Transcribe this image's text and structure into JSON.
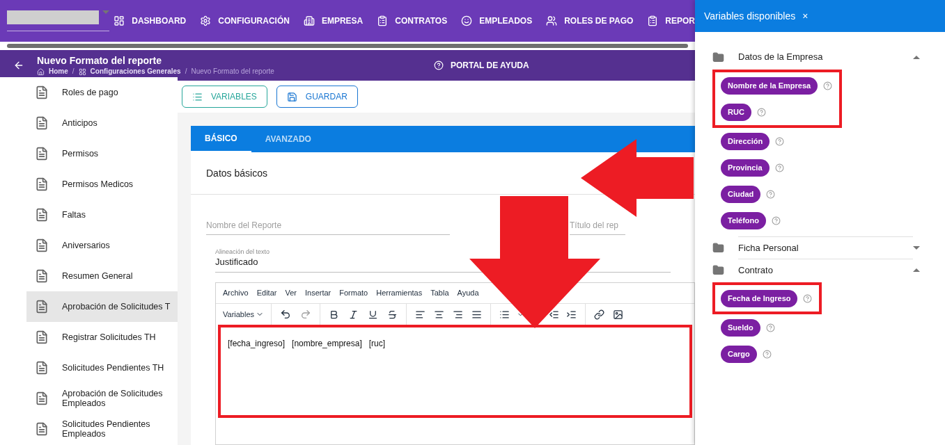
{
  "nav": {
    "items": [
      {
        "kind": "dashboard",
        "label": "DASHBOARD"
      },
      {
        "kind": "gear",
        "label": "CONFIGURACIÓN"
      },
      {
        "kind": "building",
        "label": "EMPRESA"
      },
      {
        "kind": "clipboard",
        "label": "CONTRATOS"
      },
      {
        "kind": "face",
        "label": "EMPLEADOS"
      },
      {
        "kind": "people",
        "label": "ROLES DE PAGO"
      },
      {
        "kind": "clipboard",
        "label": "REPOR"
      }
    ]
  },
  "header": {
    "title": "Nuevo Formato del reporte",
    "breadcrumbs": [
      "Home",
      "Configuraciones Generales",
      "Nuevo Formato del reporte"
    ],
    "separator": "/",
    "help": "PORTAL DE AYUDA"
  },
  "sidebar": {
    "items": [
      {
        "label": "Roles de pago",
        "selected": false
      },
      {
        "label": "Anticipos",
        "selected": false
      },
      {
        "label": "Permisos",
        "selected": false
      },
      {
        "label": "Permisos Medicos",
        "selected": false
      },
      {
        "label": "Faltas",
        "selected": false
      },
      {
        "label": "Aniversarios",
        "selected": false
      },
      {
        "label": "Resumen General",
        "selected": false
      },
      {
        "label": "Aprobación de Solicitudes T",
        "selected": true
      },
      {
        "label": "Registrar Solicitudes TH",
        "selected": false
      },
      {
        "label": "Solicitudes Pendientes TH",
        "selected": false
      },
      {
        "label": "Aprobación de Solicitudes Empleados",
        "selected": false
      },
      {
        "label": "Solicitudes Pendientes Empleados",
        "selected": false
      }
    ]
  },
  "actions": [
    {
      "kind": "list",
      "label": "VARIABLES"
    },
    {
      "kind": "save",
      "label": "GUARDAR"
    }
  ],
  "tabs": [
    {
      "label": "BÁSICO",
      "selected": true
    },
    {
      "label": "AVANZADO",
      "selected": false
    }
  ],
  "form": {
    "section": "Datos básicos",
    "fields": [
      {
        "placeholder": "Nombre del Reporte"
      },
      {
        "placeholder": "Título del rep"
      }
    ],
    "alignment": {
      "label": "Alineación del texto",
      "value": "Justificado"
    }
  },
  "editor": {
    "menu": [
      "Archivo",
      "Editar",
      "Ver",
      "Insertar",
      "Formato",
      "Herramientas",
      "Tabla",
      "Ayuda"
    ],
    "variables": "Variables",
    "content": "[fecha_ingreso]   [nombre_empresa]   [ruc]",
    "highlighted": true
  },
  "panel": {
    "title": "Variables disponibles",
    "close": "×",
    "groups": [
      {
        "name": "Datos de la Empresa",
        "expanded": true,
        "chips": [
          {
            "label": "Nombre de la Empresa",
            "highlighted": true
          },
          {
            "label": "RUC",
            "highlighted": true
          },
          {
            "label": "Dirección",
            "highlighted": false
          },
          {
            "label": "Provincia",
            "highlighted": false
          },
          {
            "label": "Ciudad",
            "highlighted": false
          },
          {
            "label": "Teléfono",
            "highlighted": false
          }
        ]
      },
      {
        "name": "Ficha Personal",
        "expanded": false
      },
      {
        "name": "Contrato",
        "expanded": true,
        "chips": [
          {
            "label": "Fecha de Ingreso",
            "highlighted": true
          },
          {
            "label": "Sueldo",
            "highlighted": false
          },
          {
            "label": "Cargo",
            "highlighted": false
          }
        ]
      }
    ]
  }
}
